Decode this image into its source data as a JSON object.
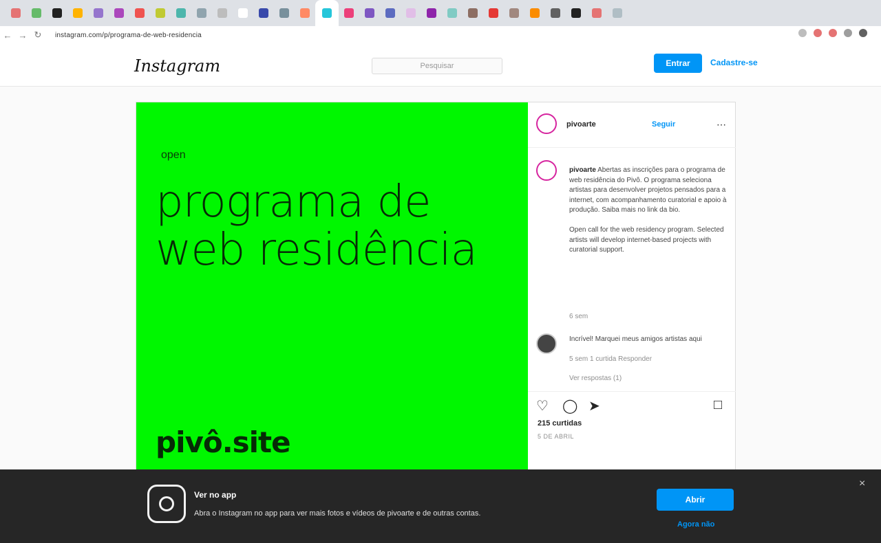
{
  "browser": {
    "tab_colors": [
      "#e57373",
      "#66bb6a",
      "#212121",
      "#ffb300",
      "#9575cd",
      "#ab47bc",
      "#ef5350",
      "#c0ca33",
      "#4db6ac",
      "#90a4ae",
      "#bdbdbd",
      "#ffffff",
      "#3949ab",
      "#78909c",
      "#ff8a65",
      "#26c6da",
      "#ec407a",
      "#7e57c2",
      "#5c6bc0",
      "#e1bee7",
      "#8e24aa",
      "#80cbc4",
      "#8d6e63",
      "#e53935",
      "#a1887f",
      "#fb8c00",
      "#616161",
      "#212121",
      "#e57373",
      "#b0bec5"
    ],
    "url": "instagram.com/p/programa-de-web-residencia"
  },
  "header": {
    "logo": "Instagram",
    "search_placeholder": "Pesquisar",
    "login_label": "Entrar",
    "signup_label": "Cadastre-se"
  },
  "post": {
    "image": {
      "small_text": "open",
      "title": "programa de web residência",
      "brand": "pivô.site"
    },
    "author": {
      "username": "pivoarte",
      "follow_label": "Seguir"
    },
    "caption": {
      "username": "pivoarte",
      "text": "Abertas as inscrições para o programa de web residência do Pivô. O programa seleciona artistas para desenvolver projetos pensados para a internet, com acompanhamento curatorial e apoio à produção. Saiba mais no link da bio.",
      "text2": "Open call for the web residency program. Selected artists will develop internet-based projects with curatorial support.",
      "time": "6 sem"
    },
    "comment": {
      "text": "Incrível! Marquei meus amigos artistas aqui",
      "meta": "5 sem  1 curtida  Responder",
      "replies": "Ver respostas (1)"
    },
    "likes": "215 curtidas",
    "date": "5 DE ABRIL"
  },
  "banner": {
    "title": "Ver no app",
    "text": "Abra o Instagram no app para ver mais fotos e vídeos de pivoarte e de outras contas.",
    "button": "Abrir",
    "link": "Agora não",
    "close": "×"
  }
}
